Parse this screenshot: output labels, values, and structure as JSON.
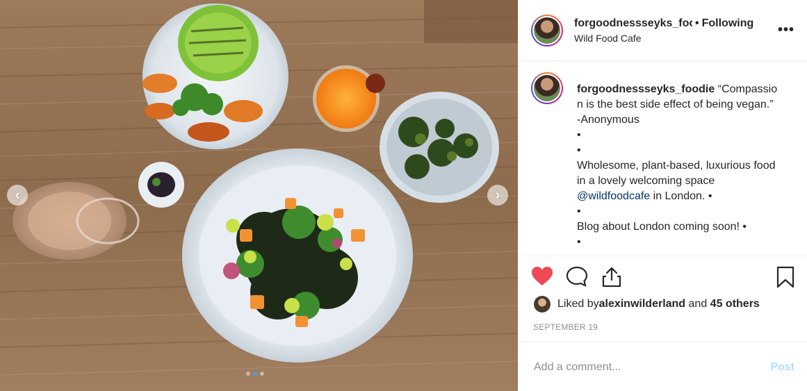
{
  "header": {
    "username": "forgoodnessseyks_foodie",
    "separator": "•",
    "follow_status": "Following",
    "location": "Wild Food Cafe",
    "more_icon": "more-horizontal-icon"
  },
  "media": {
    "prev_icon": "chevron-left-icon",
    "next_icon": "chevron-right-icon",
    "dots_total": 3,
    "dot_active": 2
  },
  "caption": {
    "username": "forgoodnessseyks_foodie",
    "quote": "“Compassion is the best side effect of being vegan.” -Anonymous",
    "lines": [
      "•",
      "•"
    ],
    "body_1": "Wholesome, plant-based, luxurious food in a lovely welcoming space",
    "mention": "@wildfoodcafe",
    "body_2": " in London. •",
    "bullet_3": "•",
    "body_3": "Blog about London coming soon! •",
    "bullet_4": "•"
  },
  "actions": {
    "like_icon": "heart-filled-icon",
    "comment_icon": "comment-icon",
    "share_icon": "share-icon",
    "save_icon": "bookmark-icon",
    "like_color": "#ed4956"
  },
  "likes": {
    "prefix": "Liked by ",
    "liker": "alexinwilderland",
    "middle": " and ",
    "others": "45 others"
  },
  "date": "SEPTEMBER 19",
  "comment_box": {
    "placeholder": "Add a comment...",
    "post_label": "Post"
  }
}
